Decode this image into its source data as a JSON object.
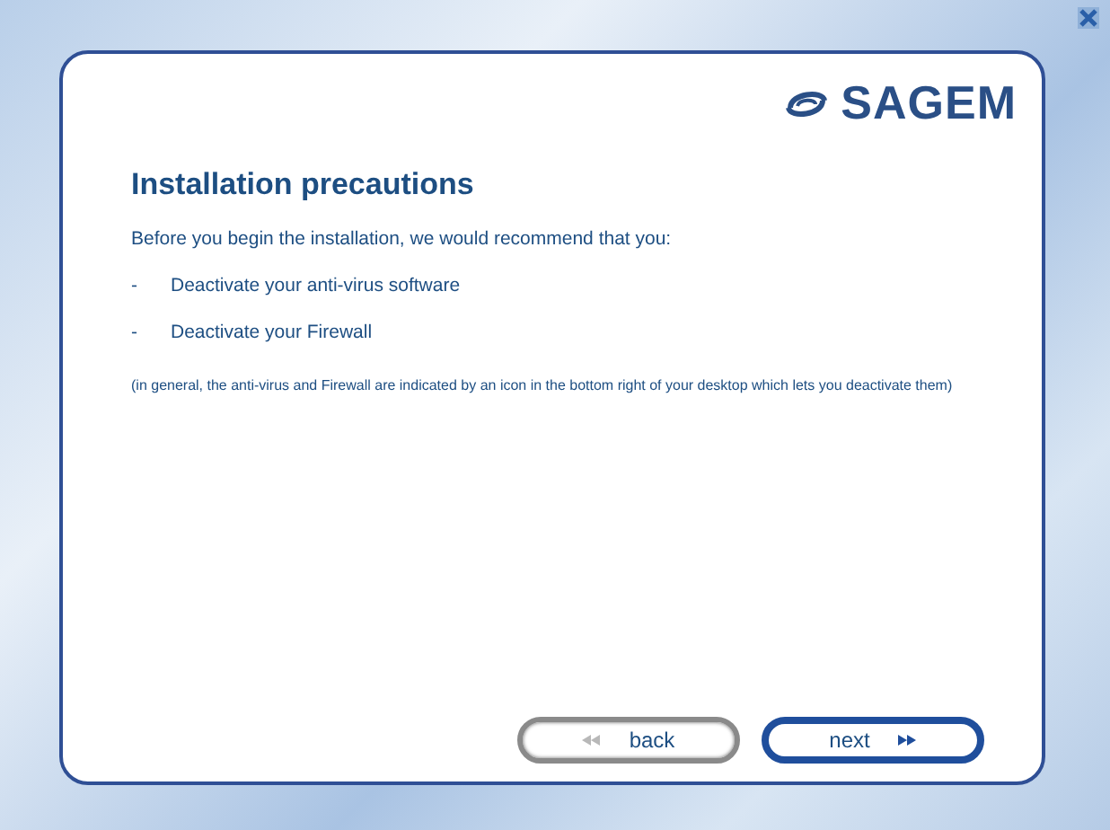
{
  "logo": {
    "text": "SAGEM"
  },
  "title": "Installation precautions",
  "intro": "Before you begin the installation, we would recommend that you:",
  "items": [
    {
      "bullet": "-",
      "text": "Deactivate your anti-virus software"
    },
    {
      "bullet": "-",
      "text": "Deactivate your Firewall"
    }
  ],
  "note": "(in general, the anti-virus and Firewall are indicated by an icon in the bottom right of your desktop which lets you deactivate them)",
  "buttons": [
    {
      "kind": "back",
      "label": "back"
    },
    {
      "kind": "next",
      "label": "next"
    }
  ]
}
